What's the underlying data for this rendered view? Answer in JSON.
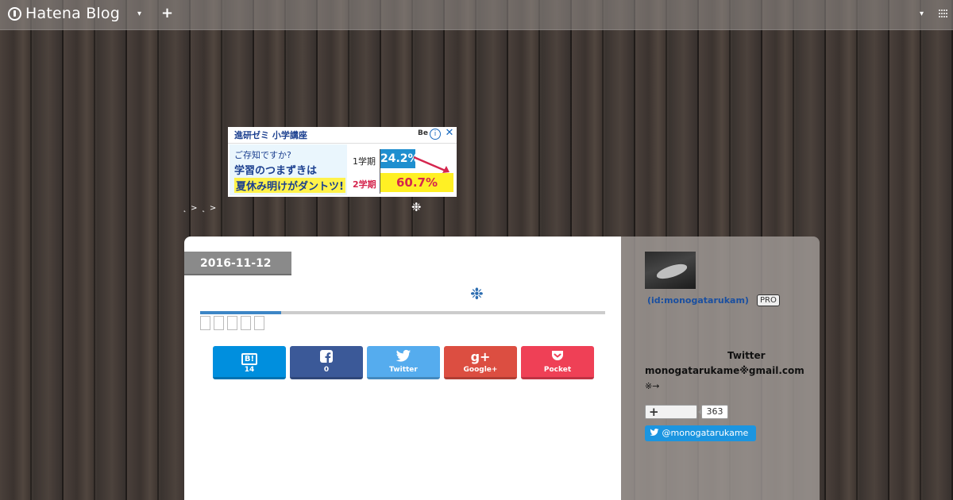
{
  "topbar": {
    "logo_text": "Hatena Blog",
    "caret": "▾",
    "plus": "+",
    "right_caret": "▾"
  },
  "ad": {
    "header": "進研ゼミ 小学講座",
    "line1": "ご存知ですか?",
    "line2": "学習のつまずきは",
    "line3": "夏休み明けがダントツ!",
    "term1": "1学期",
    "term2": "2学期",
    "value1": "24.2%",
    "value2": "60.7%",
    "logo": "Be",
    "info": "i",
    "close": "✕"
  },
  "breadcrumb": "˛ > ˛ >",
  "ornament": "❉",
  "entry": {
    "date": "2016-11-12",
    "progress": 0.2,
    "share": [
      {
        "label": "14",
        "icon": "B!"
      },
      {
        "label": "0",
        "icon": "f"
      },
      {
        "label": "Twitter",
        "icon": "🐦"
      },
      {
        "label": "Google+",
        "icon": "g+"
      },
      {
        "label": "Pocket",
        "icon": "⌄"
      }
    ]
  },
  "sidebar": {
    "author_id": "(id:monogatarukam)",
    "pro": "PRO",
    "twitter_label": "Twitter",
    "email": "monogatarukame※gmail.com",
    "arrow_note": "※→",
    "follow_plus": "+",
    "follow_count": "363",
    "twitter_handle": "@monogatarukame"
  },
  "colors": {
    "hatena": "#008fde",
    "facebook": "#3b5998",
    "twitter": "#55acee",
    "google": "#dc4e41",
    "pocket": "#ef4056"
  }
}
